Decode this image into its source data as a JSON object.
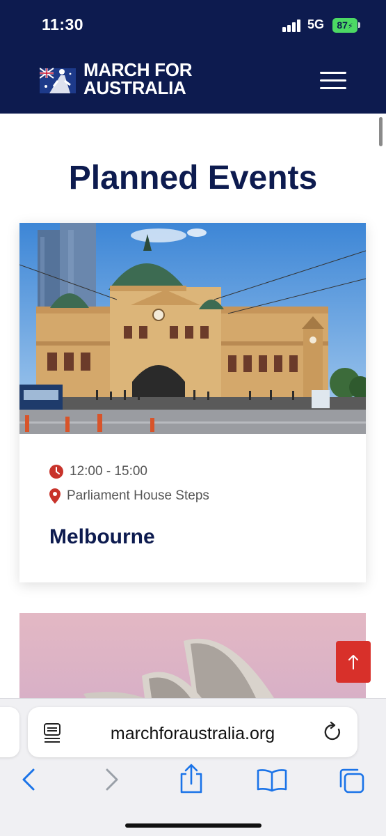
{
  "status_bar": {
    "time": "11:30",
    "network": "5G",
    "battery": "87"
  },
  "header": {
    "brand_line1": "MARCH FOR",
    "brand_line2": "AUSTRALIA"
  },
  "page": {
    "title": "Planned Events"
  },
  "events": [
    {
      "time": "12:00 - 15:00",
      "location": "Parliament House Steps",
      "city": "Melbourne"
    }
  ],
  "browser": {
    "url": "marchforaustralia.org"
  },
  "colors": {
    "navy": "#0d1b4f",
    "accent_red": "#d8302a",
    "link_blue": "#1a73e8"
  },
  "icons": [
    "clock-icon",
    "location-pin-icon",
    "menu-icon",
    "arrow-up-icon",
    "reader-icon",
    "reload-icon",
    "back-icon",
    "forward-icon",
    "share-icon",
    "bookmarks-icon",
    "tabs-icon"
  ]
}
